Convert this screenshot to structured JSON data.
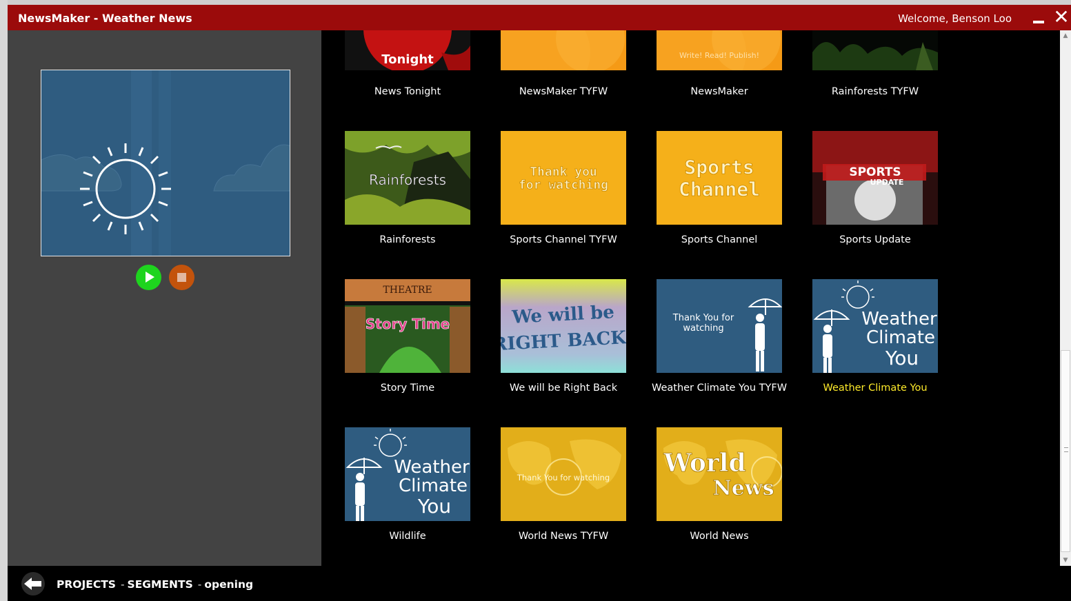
{
  "window": {
    "title": "NewsMaker - Weather News",
    "welcome": "Welcome,  Benson Loo",
    "minimize_label": "",
    "close_label": "✕"
  },
  "preview": {
    "play_icon": "play-icon",
    "stop_icon": "stop-icon"
  },
  "segments": [
    {
      "caption": "News Tonight",
      "thumb_text": "Tonight",
      "theme": "news-tonight"
    },
    {
      "caption": "NewsMaker TYFW",
      "thumb_text": "",
      "theme": "orange"
    },
    {
      "caption": "NewsMaker",
      "thumb_text": "Write! Read! Publish!",
      "theme": "orange"
    },
    {
      "caption": "Rainforests TYFW",
      "thumb_text": "",
      "theme": "rainforest-dark"
    },
    {
      "caption": "Rainforests",
      "thumb_text": "Rainforests",
      "theme": "rainforest"
    },
    {
      "caption": "Sports Channel TYFW",
      "thumb_text": "Thank you for watching",
      "theme": "gold"
    },
    {
      "caption": "Sports Channel",
      "thumb_text": "Sports Channel",
      "theme": "gold"
    },
    {
      "caption": "Sports Update",
      "thumb_text": "SPORTS UPDATE",
      "theme": "sports-update"
    },
    {
      "caption": "Story Time",
      "thumb_text": "Story Time",
      "theme": "story"
    },
    {
      "caption": "We will be Right Back",
      "thumb_text": "We will be RIGHT BACK!",
      "theme": "rightback"
    },
    {
      "caption": "Weather Climate You TYFW",
      "thumb_text": "Thank You for watching",
      "theme": "weather-tyfw"
    },
    {
      "caption": "Weather Climate You",
      "thumb_text": "Weather Climate You",
      "theme": "weather",
      "selected": true
    },
    {
      "caption": "Wildlife",
      "thumb_text": "Weather Climate You",
      "theme": "weather"
    },
    {
      "caption": "World News TYFW",
      "thumb_text": "Thank You for watching",
      "theme": "world-tyfw"
    },
    {
      "caption": "World News",
      "thumb_text": "World News",
      "theme": "world"
    }
  ],
  "breadcrumb": {
    "projects": "PROJECTS",
    "segments": "SEGMENTS",
    "current": "opening",
    "separator": "-"
  },
  "colors": {
    "titlebar": "#9b0b0b",
    "selected_caption": "#ffeb2a",
    "play": "#1ed41e",
    "stop": "#c3530c"
  }
}
